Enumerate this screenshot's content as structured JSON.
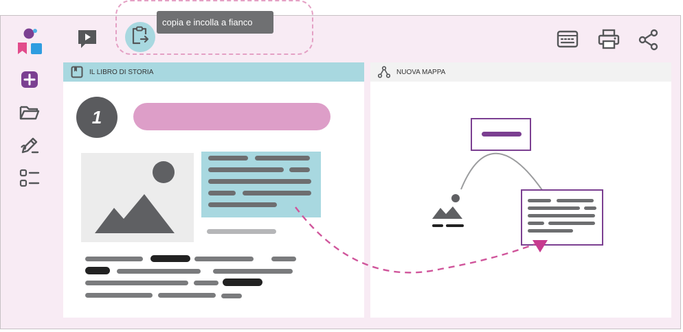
{
  "toolbar": {
    "tooltip": "copia e incolla a fianco"
  },
  "left_panel": {
    "title": "IL LIBRO DI STORIA",
    "step_number": "1",
    "header_color": "#a8d8e0"
  },
  "right_panel": {
    "title": "NUOVA MAPPA",
    "header_color": "#f2f2f2"
  },
  "colors": {
    "background": "#f8ebf4",
    "accent_pink": "#dd9ec8",
    "accent_purple": "#7b3f91",
    "accent_cyan": "#a8d8e0",
    "dashed_arrow": "#d0559b",
    "icon_grey": "#555759"
  },
  "icons": {
    "logo": "app-logo",
    "sidebar": [
      "plus-icon",
      "folder-icon",
      "edit-icon",
      "list-icon"
    ],
    "top_left": [
      "play-icon",
      "clipboard-paste-icon"
    ],
    "top_right": [
      "keyboard-icon",
      "printer-icon",
      "share-icon"
    ]
  }
}
